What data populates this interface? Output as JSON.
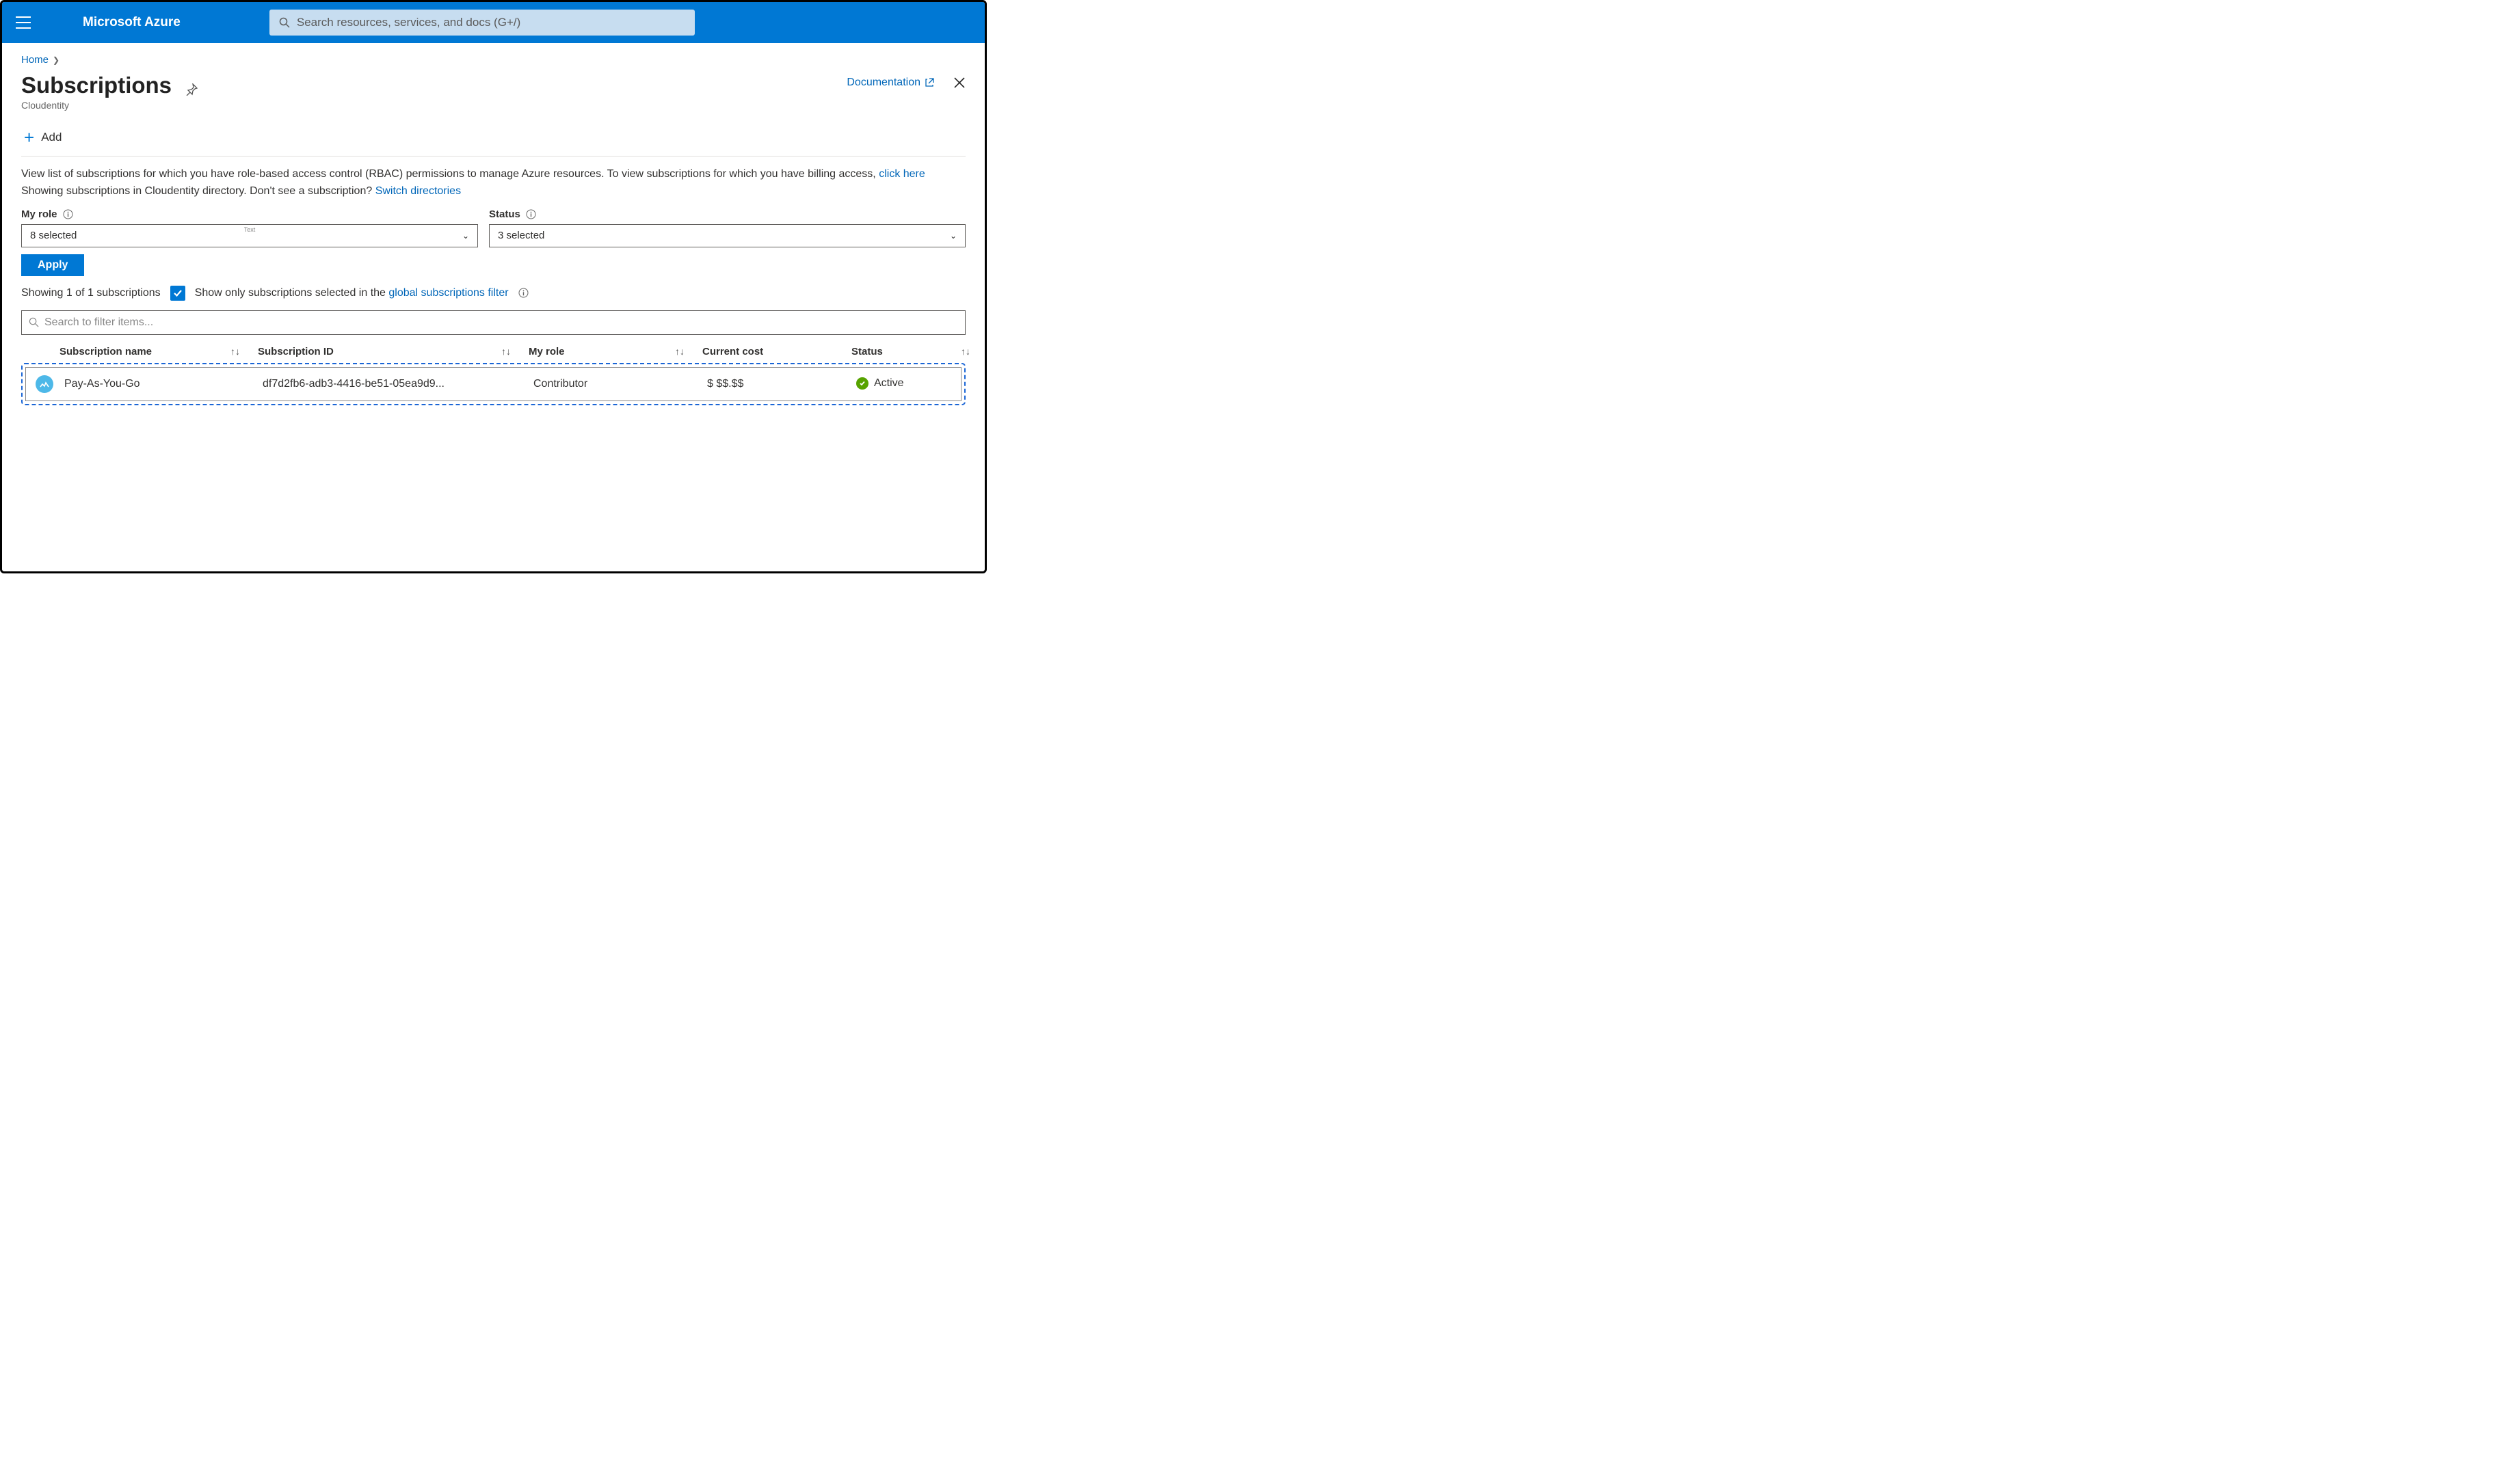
{
  "header": {
    "brand": "Microsoft Azure",
    "search_placeholder": "Search resources, services, and docs (G+/)"
  },
  "breadcrumb": {
    "home": "Home"
  },
  "page": {
    "title": "Subscriptions",
    "subtitle": "Cloudentity",
    "documentation": "Documentation"
  },
  "toolbar": {
    "add": "Add"
  },
  "description": {
    "line1a": "View list of subscriptions for which you have role-based access control (RBAC) permissions to manage Azure resources. To view subscriptions for which you have billing access, ",
    "click_here": "click here",
    "line2a": "Showing subscriptions in Cloudentity directory. Don't see a subscription? ",
    "switch_dirs": "Switch directories"
  },
  "filters": {
    "role_label": "My role",
    "role_value": "8 selected",
    "role_hint": "Text",
    "status_label": "Status",
    "status_value": "3 selected",
    "apply": "Apply"
  },
  "showing": {
    "count_text": "Showing 1 of 1 subscriptions",
    "checkbox_label_a": "Show only subscriptions selected in the ",
    "global_filter": "global subscriptions filter"
  },
  "filter_items_placeholder": "Search to filter items...",
  "columns": {
    "name": "Subscription name",
    "id": "Subscription ID",
    "role": "My role",
    "cost": "Current cost",
    "status": "Status"
  },
  "rows": [
    {
      "name": "Pay-As-You-Go",
      "id": "df7d2fb6-adb3-4416-be51-05ea9d9...",
      "role": "Contributor",
      "cost": "$ $$.$$",
      "status": "Active"
    }
  ]
}
